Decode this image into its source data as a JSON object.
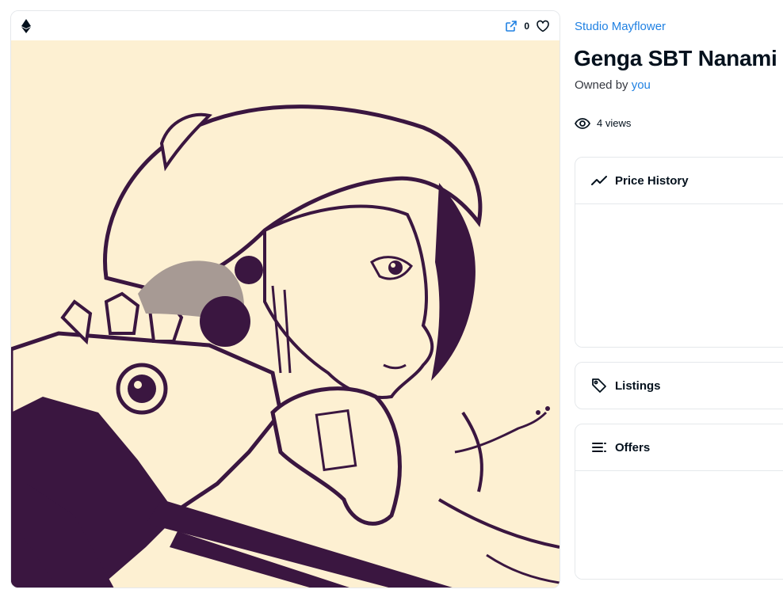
{
  "media": {
    "like_count": "0",
    "chain_icon": "ethereum-icon",
    "external_icon": "external-link-icon",
    "favorite_icon": "heart-icon",
    "artwork_colors": {
      "background": "#fdf0d2",
      "ink": "#3a1640",
      "shade": "#a79a94"
    }
  },
  "item": {
    "collection": "Studio Mayflower",
    "title": "Genga SBT Nanami",
    "owned_by_label": "Owned by",
    "owner": "you",
    "views": "4 views"
  },
  "panels": {
    "price_history": "Price History",
    "listings": "Listings",
    "offers": "Offers"
  },
  "colors": {
    "link": "#2081e2",
    "text": "#04111d",
    "border": "#e5e8eb"
  }
}
